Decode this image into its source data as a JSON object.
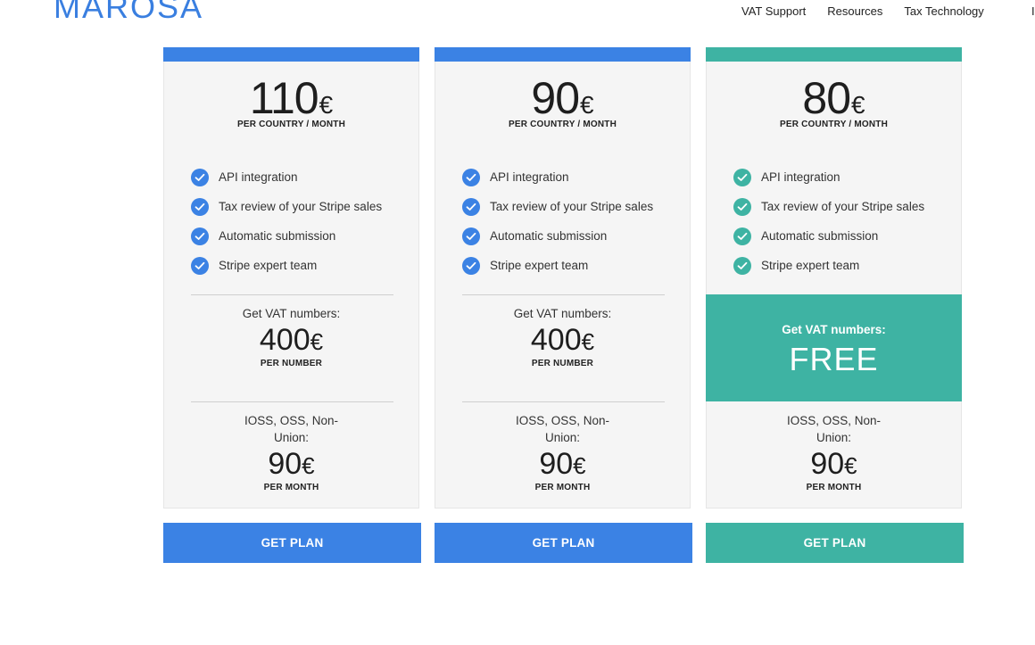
{
  "header": {
    "logo_text": "MAROSA",
    "nav": [
      "VAT Support",
      "Resources",
      "Tax Technology"
    ],
    "nav_edge": "I"
  },
  "colors": {
    "blue": "#3b82e4",
    "teal": "#3eb3a3"
  },
  "plans": [
    {
      "accent": "blue",
      "price": "110",
      "currency": "€",
      "price_sub": "PER COUNTRY / MONTH",
      "features": [
        "API integration",
        "Tax review of your Stripe sales",
        "Automatic submission",
        "Stripe expert team"
      ],
      "vat_label": "Get VAT numbers:",
      "vat_price": "400",
      "vat_currency": "€",
      "vat_sub": "PER NUMBER",
      "ioss_label": "IOSS, OSS, Non-Union:",
      "ioss_price": "90",
      "ioss_currency": "€",
      "ioss_sub": "PER MONTH",
      "button": "GET PLAN"
    },
    {
      "accent": "blue",
      "price": "90",
      "currency": "€",
      "price_sub": "PER COUNTRY / MONTH",
      "features": [
        "API integration",
        "Tax review of your Stripe sales",
        "Automatic submission",
        "Stripe expert team"
      ],
      "vat_label": "Get VAT numbers:",
      "vat_price": "400",
      "vat_currency": "€",
      "vat_sub": "PER NUMBER",
      "ioss_label": "IOSS, OSS, Non-Union:",
      "ioss_price": "90",
      "ioss_currency": "€",
      "ioss_sub": "PER MONTH",
      "button": "GET PLAN"
    },
    {
      "accent": "teal",
      "price": "80",
      "currency": "€",
      "price_sub": "PER COUNTRY / MONTH",
      "features": [
        "API integration",
        "Tax review of your Stripe sales",
        "Automatic submission",
        "Stripe expert team"
      ],
      "vat_label": "Get VAT numbers:",
      "vat_value": "FREE",
      "ioss_label": "IOSS, OSS, Non-Union:",
      "ioss_price": "90",
      "ioss_currency": "€",
      "ioss_sub": "PER MONTH",
      "button": "GET PLAN"
    }
  ]
}
